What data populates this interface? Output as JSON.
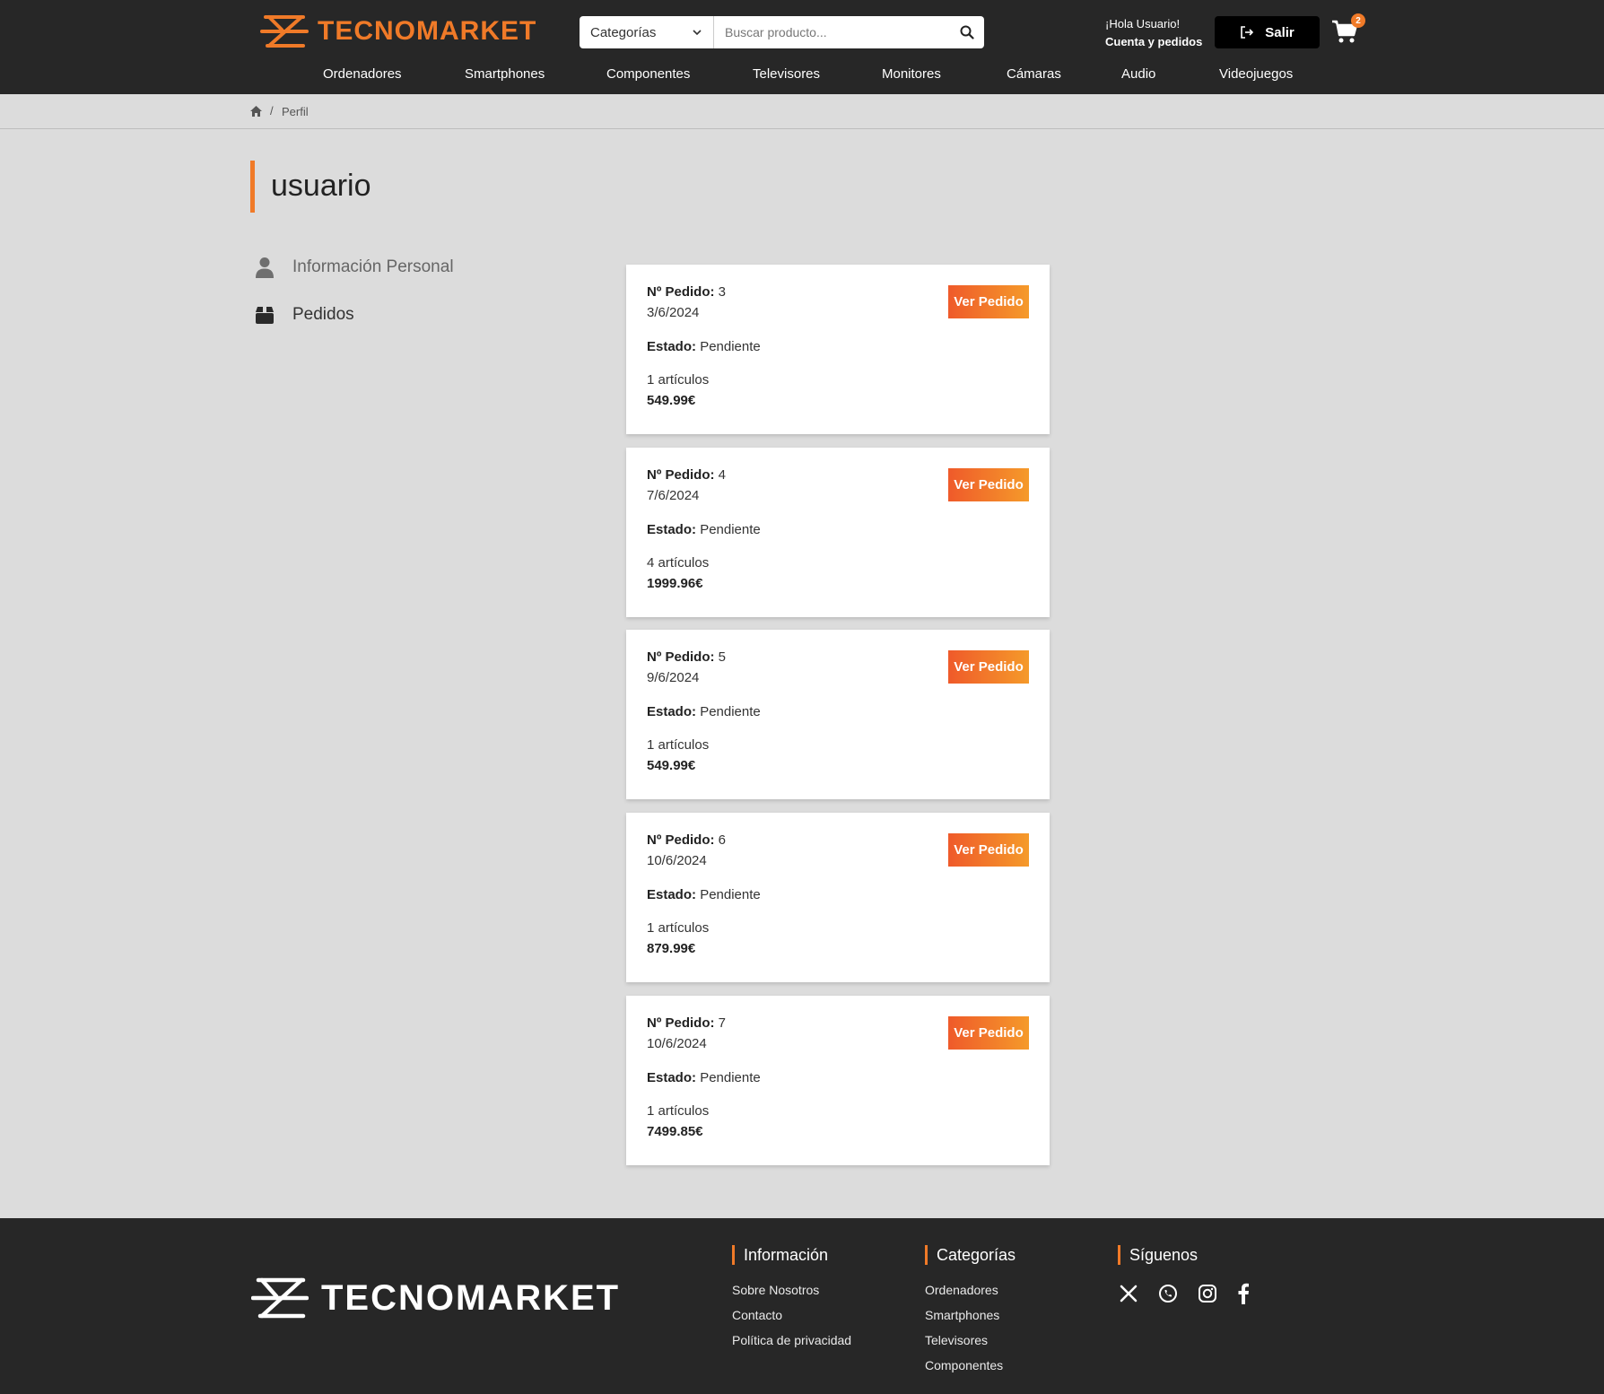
{
  "brand": {
    "name": "TECNOMARKET",
    "accent": "#f07a28",
    "header_bg": "#272727",
    "page_bg": "#dcdcdc"
  },
  "search": {
    "category_label": "Categorías",
    "placeholder": "Buscar producto..."
  },
  "user": {
    "greeting": "¡Hola Usuario!",
    "account_link": "Cuenta y pedidos",
    "logout_label": "Salir"
  },
  "cart": {
    "count": "2"
  },
  "nav": [
    "Ordenadores",
    "Smartphones",
    "Componentes",
    "Televisores",
    "Monitores",
    "Cámaras",
    "Audio",
    "Videojuegos"
  ],
  "breadcrumb": {
    "separator": "/",
    "current": "Perfil"
  },
  "profile": {
    "title": "usuario"
  },
  "sidebar": [
    {
      "label": "Información Personal",
      "icon": "user-icon"
    },
    {
      "label": "Pedidos",
      "icon": "box-icon"
    }
  ],
  "orders": {
    "labels": {
      "number": "Nº Pedido:",
      "status": "Estado:",
      "view": "Ver Pedido"
    },
    "items": [
      {
        "number": "3",
        "date": "3/6/2024",
        "status": "Pendiente",
        "items": "1 artículos",
        "total": "549.99€"
      },
      {
        "number": "4",
        "date": "7/6/2024",
        "status": "Pendiente",
        "items": "4 artículos",
        "total": "1999.96€"
      },
      {
        "number": "5",
        "date": "9/6/2024",
        "status": "Pendiente",
        "items": "1 artículos",
        "total": "549.99€"
      },
      {
        "number": "6",
        "date": "10/6/2024",
        "status": "Pendiente",
        "items": "1 artículos",
        "total": "879.99€"
      },
      {
        "number": "7",
        "date": "10/6/2024",
        "status": "Pendiente",
        "items": "1 artículos",
        "total": "7499.85€"
      }
    ]
  },
  "footer": {
    "info": {
      "title": "Información",
      "links": [
        "Sobre Nosotros",
        "Contacto",
        "Política de privacidad"
      ]
    },
    "categories": {
      "title": "Categorías",
      "links": [
        "Ordenadores",
        "Smartphones",
        "Televisores",
        "Componentes"
      ]
    },
    "follow": {
      "title": "Síguenos",
      "icons": [
        "x-icon",
        "whatsapp-icon",
        "instagram-icon",
        "facebook-icon"
      ]
    }
  }
}
